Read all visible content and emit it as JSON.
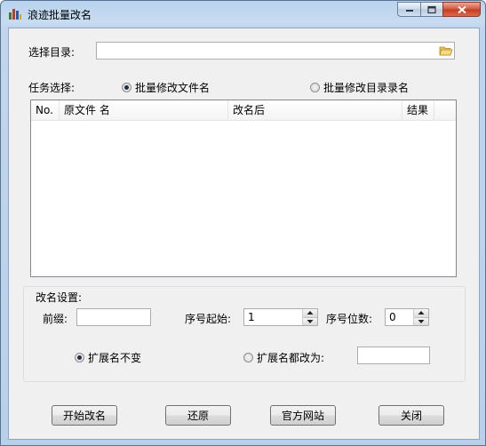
{
  "window": {
    "title": "浪迹批量改名"
  },
  "directory": {
    "label": "选择目录:",
    "value": ""
  },
  "task": {
    "label": "任务选择:",
    "options": [
      {
        "label": "批量修改文件名",
        "checked": true
      },
      {
        "label": "批量修改目录录名",
        "checked": false
      }
    ]
  },
  "table": {
    "columns": [
      "No.",
      "原文件 名",
      "改名后",
      "结果"
    ],
    "rows": []
  },
  "settings": {
    "label": "改名设置:",
    "prefix_label": "前缀:",
    "prefix_value": "",
    "seq_start_label": "序号起始:",
    "seq_start_value": "1",
    "seq_digits_label": "序号位数:",
    "seq_digits_value": "0",
    "ext_keep_label": "扩展名不变",
    "ext_change_label": "扩展名都改为:",
    "ext_value": ""
  },
  "buttons": {
    "start": "开始改名",
    "restore": "还原",
    "website": "官方网站",
    "close": "关闭"
  },
  "colors": {
    "title_bar": "#c7dcf1",
    "client_bg": "#f0f0f0",
    "close_button": "#c7381d"
  }
}
